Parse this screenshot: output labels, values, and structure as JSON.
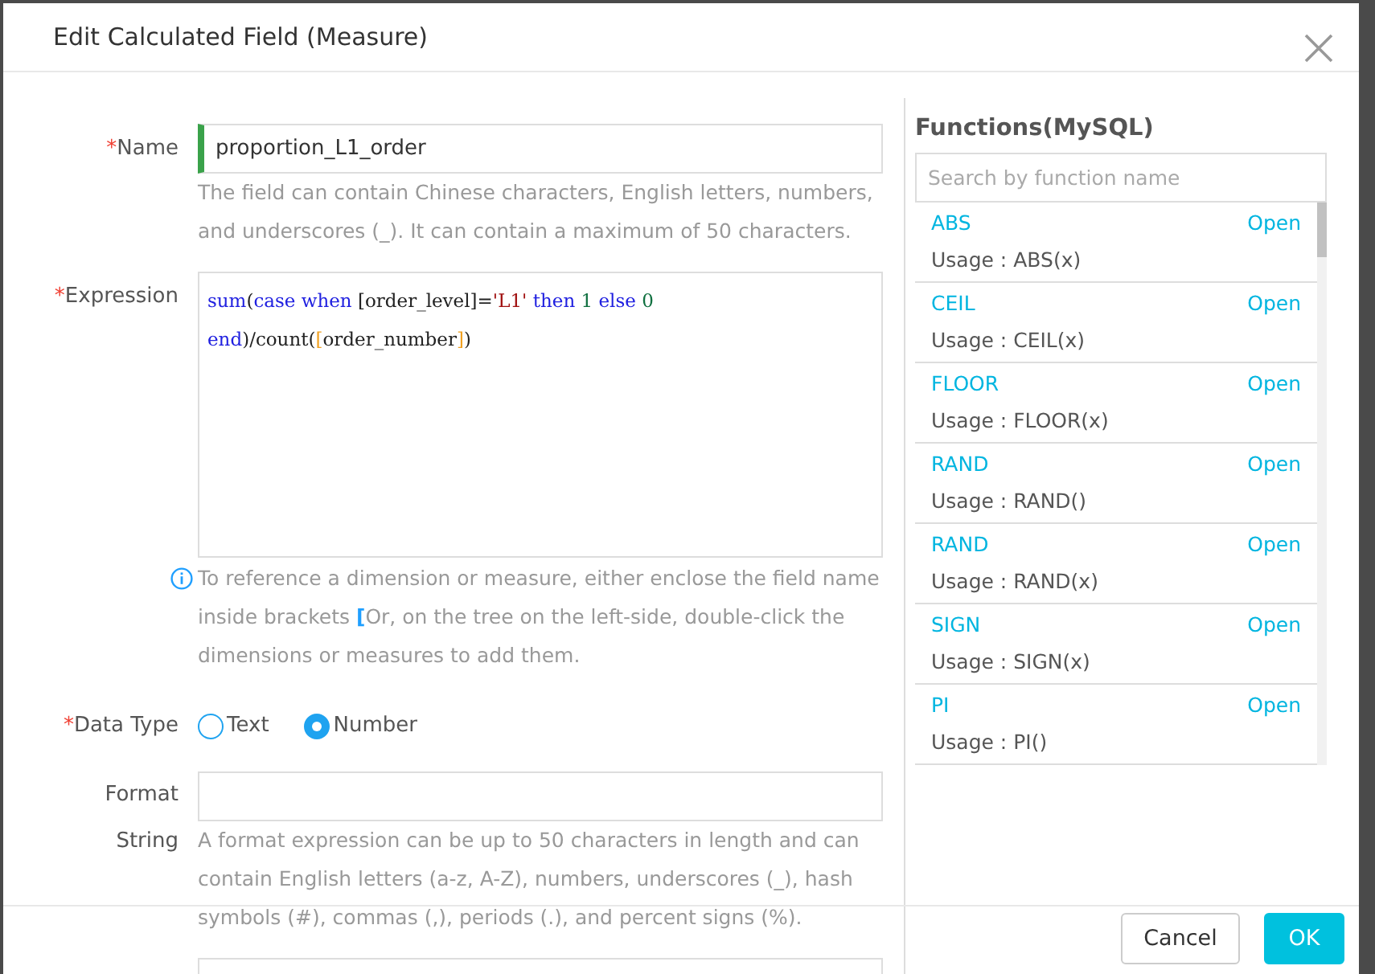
{
  "dialog": {
    "title": "Edit Calculated Field (Measure)"
  },
  "form": {
    "name": {
      "label": "Name",
      "marker": "*",
      "focused": true,
      "value": "proportion_L1_order",
      "help": "The field can contain Chinese characters, English letters, numbers, and underscores (_). It can contain a maximum of 50 characters."
    },
    "expression": {
      "label": "Expression",
      "marker": "*",
      "lines": [
        [
          {
            "kind": "keyword",
            "text": "sum"
          },
          {
            "kind": "plain",
            "text": "("
          },
          {
            "kind": "keyword",
            "text": "case when"
          },
          {
            "kind": "plain",
            "text": " [order_level]="
          },
          {
            "kind": "string",
            "text": "'L1'"
          },
          {
            "kind": "keyword",
            "text": " then"
          },
          {
            "kind": "number",
            "text": " 1"
          },
          {
            "kind": "keyword",
            "text": " else"
          },
          {
            "kind": "number",
            "text": " 0"
          }
        ],
        [
          {
            "kind": "keyword",
            "text": "end"
          },
          {
            "kind": "plain",
            "text": ")/count("
          },
          {
            "kind": "bracket",
            "text": "["
          },
          {
            "kind": "plain",
            "text": "order_number"
          },
          {
            "kind": "bracket",
            "text": "]"
          },
          {
            "kind": "plain",
            "text": ")"
          }
        ]
      ],
      "help": [
        {
          "kind": "plain",
          "text": "To reference a dimension or measure, either enclose the field name inside brackets "
        },
        {
          "kind": "accent",
          "text": "["
        },
        {
          "kind": "plain",
          "text": "Or, on the tree on the left-side, double-click the dimensions or measures to add them."
        }
      ]
    },
    "data_type": {
      "label": "Data Type",
      "marker": "*",
      "options": [
        {
          "label": "Text",
          "selected": false
        },
        {
          "label": "Number",
          "selected": true
        }
      ]
    },
    "format_string": {
      "label": "Format String",
      "help": "A format expression can be up to 50 characters in length and can contain English letters (a-z, A-Z), numbers, underscores (_), hash symbols (#), commas (,), periods (.), and percent signs (%)."
    }
  },
  "functions": {
    "title": "Functions(MySQL)",
    "search_placeholder": "Search by function name",
    "items": [
      {
        "name": "ABS",
        "action": "Open",
        "usage": "Usage : ABS(x)"
      },
      {
        "name": "CEIL",
        "action": "Open",
        "usage": "Usage : CEIL(x)"
      },
      {
        "name": "FLOOR",
        "action": "Open",
        "usage": "Usage : FLOOR(x)"
      },
      {
        "name": "RAND",
        "action": "Open",
        "usage": "Usage : RAND()"
      },
      {
        "name": "RAND",
        "action": "Open",
        "usage": "Usage : RAND(x)"
      },
      {
        "name": "SIGN",
        "action": "Open",
        "usage": "Usage : SIGN(x)"
      },
      {
        "name": "PI",
        "action": "Open",
        "usage": "Usage : PI()"
      }
    ]
  },
  "footer": {
    "buttons": [
      {
        "label": "Cancel",
        "kind": "secondary"
      },
      {
        "label": "OK",
        "kind": "primary"
      }
    ]
  }
}
